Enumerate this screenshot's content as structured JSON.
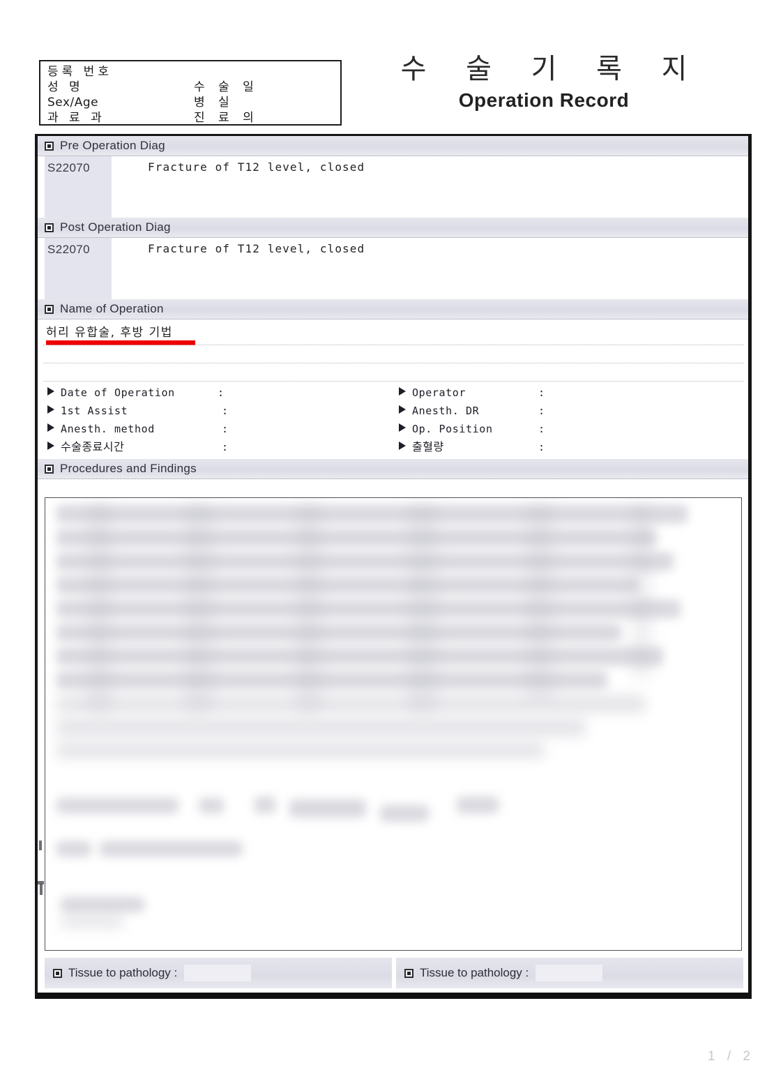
{
  "document": {
    "title_ko": "수 술 기 록 지",
    "title_en": "Operation Record",
    "page_number": "1 /  2"
  },
  "patient_box": {
    "rows": [
      {
        "left": "등록 번호",
        "right": ""
      },
      {
        "left": "성      명",
        "right": "수 술 일"
      },
      {
        "left": "Sex/Age",
        "right": "병    실"
      },
      {
        "left": "과 료 과",
        "right": "진 료 의"
      }
    ]
  },
  "sections": {
    "pre_op": {
      "header": "Pre Operation Diag",
      "code": "S22070",
      "diagnosis": "Fracture of T12 level, closed"
    },
    "post_op": {
      "header": "Post Operation Diag",
      "code": "S22070",
      "diagnosis": "Fracture of T12 level, closed"
    },
    "name_of_operation": {
      "header": "Name of Operation",
      "value": "허리 유합술, 후방 기법"
    },
    "procedures": {
      "header": "Procedures and Findings",
      "body": ""
    }
  },
  "fields": {
    "left": [
      {
        "label": "Date of Operation",
        "colon": ":",
        "value": ""
      },
      {
        "label": "1st Assist",
        "colon": ":",
        "value": ""
      },
      {
        "label": "Anesth. method",
        "colon": ":",
        "value": ""
      },
      {
        "label": "수술종료시간",
        "colon": ":",
        "value": ""
      }
    ],
    "right": [
      {
        "label": "Operator",
        "colon": ":",
        "value": ""
      },
      {
        "label": "Anesth. DR",
        "colon": ":",
        "value": ""
      },
      {
        "label": "Op. Position",
        "colon": ":",
        "value": ""
      },
      {
        "label": "출혈량",
        "colon": ":",
        "value": ""
      }
    ]
  },
  "footer": {
    "pathology_left": "Tissue to pathology :",
    "pathology_right": "Tissue to pathology :",
    "pathology_left_value": "",
    "pathology_right_value": ""
  },
  "colors": {
    "section_bar": "#dcdce6",
    "code_cell": "#e4e4ee",
    "red_underline": "#ee0000",
    "frame_border": "#171717",
    "paper": "#ffffff"
  }
}
